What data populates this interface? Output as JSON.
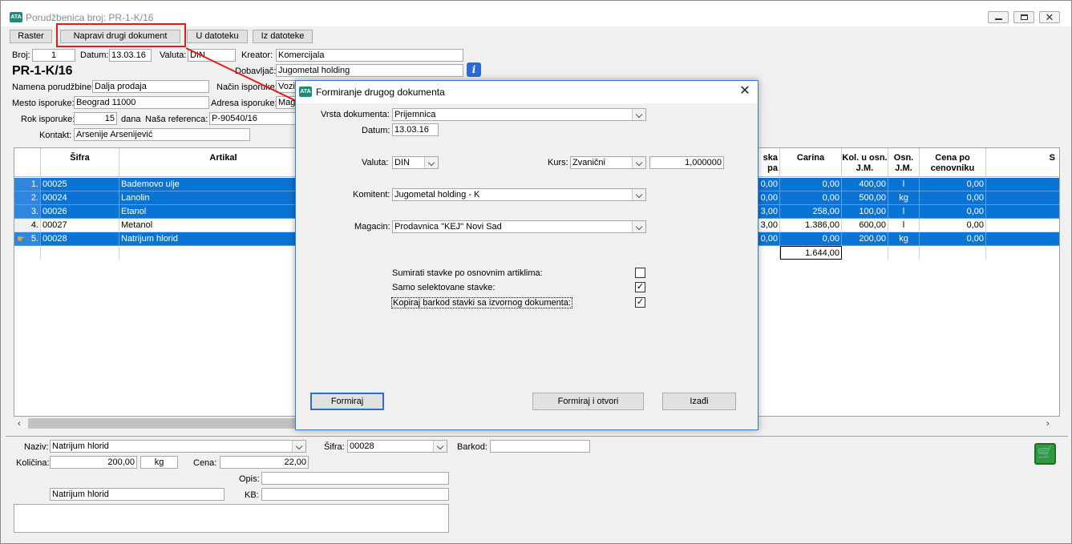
{
  "window": {
    "title": "Porudžbenica broj: PR-1-K/16",
    "icon_text": "ATA",
    "controls": [
      "minimize-icon",
      "maximize-icon",
      "close-icon"
    ]
  },
  "toolbar": {
    "raster": "Raster",
    "napravi": "Napravi drugi dokument",
    "u_datoteku": "U datoteku",
    "iz_datoteke": "Iz datoteke"
  },
  "header": {
    "broj_label": "Broj:",
    "broj": "1",
    "datum_label": "Datum:",
    "datum": "13.03.16",
    "valuta_label": "Valuta:",
    "valuta": "DIN",
    "kreator_label": "Kreator:",
    "kreator": "Komercijala",
    "doc_no": "PR-1-K/16",
    "dobavljac_label": "Dobavljač:",
    "dobavljac": "Jugometal holding",
    "namena_label": "Namena porudžbine:",
    "namena": "Dalja prodaja",
    "nacin_label": "Način isporuke:",
    "nacin": "Vozil",
    "mesto_label": "Mesto isporuke:",
    "mesto": "Beograd  11000",
    "adresa_label": "Adresa isporuke:",
    "adresa": "Mag",
    "rok_label": "Rok isporuke:",
    "rok": "15",
    "dana": "dana",
    "referenca_label": "Naša referenca:",
    "referenca": "P-90540/16",
    "kontakt_label": "Kontakt:",
    "kontakt": "Arsenije Arsenijević"
  },
  "grid": {
    "headers": {
      "sifra": "Šifra",
      "artikal": "Artikal",
      "akciza_a": "ska",
      "akciza_b": "pa",
      "carina": "Carina",
      "kol": "Kol. u osn. J.M.",
      "osn": "Osn. J.M.",
      "cena": "Cena po cenovniku",
      "s": "S"
    },
    "rows": [
      {
        "n": "1.",
        "sifra": "00025",
        "artikal": "Bademovo ulje",
        "ak": "0,00",
        "carina": "0,00",
        "kol": "400,00",
        "jm": "l",
        "cena": "0,00",
        "selected": true
      },
      {
        "n": "2.",
        "sifra": "00024",
        "artikal": "Lanolin",
        "ak": "0,00",
        "carina": "0,00",
        "kol": "500,00",
        "jm": "kg",
        "cena": "0,00",
        "selected": true
      },
      {
        "n": "3.",
        "sifra": "00026",
        "artikal": "Etanol",
        "ak": "3,00",
        "carina": "258,00",
        "kol": "100,00",
        "jm": "l",
        "cena": "0,00",
        "selected": true
      },
      {
        "n": "4.",
        "sifra": "00027",
        "artikal": "Metanol",
        "ak": "3,00",
        "carina": "1.386,00",
        "kol": "600,00",
        "jm": "l",
        "cena": "0,00",
        "selected": false
      },
      {
        "n": "5.",
        "sifra": "00028",
        "artikal": "Natrijum hlorid",
        "ak": "0,00",
        "carina": "0,00",
        "kol": "200,00",
        "jm": "kg",
        "cena": "0,00",
        "selected": true
      }
    ],
    "total_carina": "1.644,00"
  },
  "bottom": {
    "naziv_label": "Naziv:",
    "naziv": "Natrijum hlorid",
    "sifra_label": "Šifra:",
    "sifra": "00028",
    "barkod_label": "Barkod:",
    "barkod": "",
    "kolicina_label": "Količina:",
    "kolicina": "200,00",
    "jm": "kg",
    "cena_label": "Cena:",
    "cena": "22,00",
    "opis_label": "Opis:",
    "opis": "",
    "naziv2": "Natrijum hlorid",
    "kb_label": "KB:",
    "kb": ""
  },
  "dialog": {
    "title": "Formiranje drugog dokumenta",
    "vrsta_label": "Vrsta dokumenta:",
    "vrsta": "Prijemnica",
    "datum_label": "Datum:",
    "datum": "13.03.16",
    "valuta_label": "Valuta:",
    "valuta": "DIN",
    "kurs_label": "Kurs:",
    "kurs": "Zvanični",
    "kurs_value": "1,000000",
    "komitent_label": "Komitent:",
    "komitent": "Jugometal holding - K",
    "magacin_label": "Magacin:",
    "magacin": "Prodavnica \"KEJ\" Novi Sad",
    "opt1": "Sumirati stavke po osnovnim artiklima:",
    "opt1_checked": false,
    "opt2": "Samo selektovane stavke:",
    "opt2_checked": true,
    "opt3": "Kopiraj barkod stavki sa izvornog dokumenta:",
    "opt3_checked": true,
    "btn_formiraj": "Formiraj",
    "btn_formiraj_otvori": "Formiraj i otvori",
    "btn_izadji": "Izađi"
  },
  "colors": {
    "selection": "#0a74d6",
    "annotation": "#e21b1b",
    "dialog_border": "#3a7ad1"
  }
}
